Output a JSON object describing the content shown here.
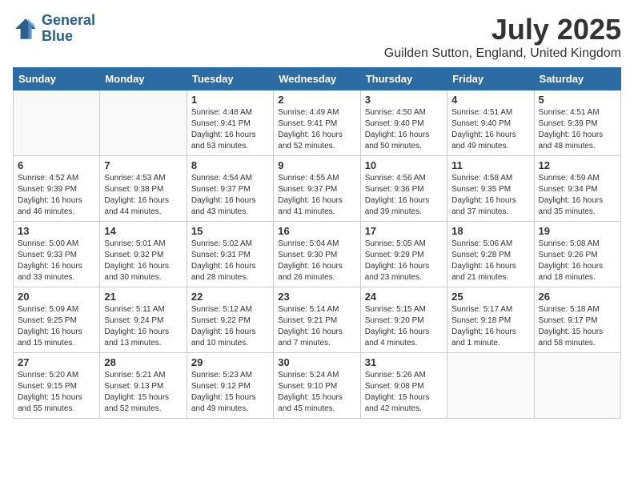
{
  "header": {
    "logo_line1": "General",
    "logo_line2": "Blue",
    "month": "July 2025",
    "location": "Guilden Sutton, England, United Kingdom"
  },
  "weekdays": [
    "Sunday",
    "Monday",
    "Tuesday",
    "Wednesday",
    "Thursday",
    "Friday",
    "Saturday"
  ],
  "weeks": [
    [
      {
        "day": "",
        "info": ""
      },
      {
        "day": "",
        "info": ""
      },
      {
        "day": "1",
        "info": "Sunrise: 4:48 AM\nSunset: 9:41 PM\nDaylight: 16 hours and 53 minutes."
      },
      {
        "day": "2",
        "info": "Sunrise: 4:49 AM\nSunset: 9:41 PM\nDaylight: 16 hours and 52 minutes."
      },
      {
        "day": "3",
        "info": "Sunrise: 4:50 AM\nSunset: 9:40 PM\nDaylight: 16 hours and 50 minutes."
      },
      {
        "day": "4",
        "info": "Sunrise: 4:51 AM\nSunset: 9:40 PM\nDaylight: 16 hours and 49 minutes."
      },
      {
        "day": "5",
        "info": "Sunrise: 4:51 AM\nSunset: 9:39 PM\nDaylight: 16 hours and 48 minutes."
      }
    ],
    [
      {
        "day": "6",
        "info": "Sunrise: 4:52 AM\nSunset: 9:39 PM\nDaylight: 16 hours and 46 minutes."
      },
      {
        "day": "7",
        "info": "Sunrise: 4:53 AM\nSunset: 9:38 PM\nDaylight: 16 hours and 44 minutes."
      },
      {
        "day": "8",
        "info": "Sunrise: 4:54 AM\nSunset: 9:37 PM\nDaylight: 16 hours and 43 minutes."
      },
      {
        "day": "9",
        "info": "Sunrise: 4:55 AM\nSunset: 9:37 PM\nDaylight: 16 hours and 41 minutes."
      },
      {
        "day": "10",
        "info": "Sunrise: 4:56 AM\nSunset: 9:36 PM\nDaylight: 16 hours and 39 minutes."
      },
      {
        "day": "11",
        "info": "Sunrise: 4:58 AM\nSunset: 9:35 PM\nDaylight: 16 hours and 37 minutes."
      },
      {
        "day": "12",
        "info": "Sunrise: 4:59 AM\nSunset: 9:34 PM\nDaylight: 16 hours and 35 minutes."
      }
    ],
    [
      {
        "day": "13",
        "info": "Sunrise: 5:00 AM\nSunset: 9:33 PM\nDaylight: 16 hours and 33 minutes."
      },
      {
        "day": "14",
        "info": "Sunrise: 5:01 AM\nSunset: 9:32 PM\nDaylight: 16 hours and 30 minutes."
      },
      {
        "day": "15",
        "info": "Sunrise: 5:02 AM\nSunset: 9:31 PM\nDaylight: 16 hours and 28 minutes."
      },
      {
        "day": "16",
        "info": "Sunrise: 5:04 AM\nSunset: 9:30 PM\nDaylight: 16 hours and 26 minutes."
      },
      {
        "day": "17",
        "info": "Sunrise: 5:05 AM\nSunset: 9:29 PM\nDaylight: 16 hours and 23 minutes."
      },
      {
        "day": "18",
        "info": "Sunrise: 5:06 AM\nSunset: 9:28 PM\nDaylight: 16 hours and 21 minutes."
      },
      {
        "day": "19",
        "info": "Sunrise: 5:08 AM\nSunset: 9:26 PM\nDaylight: 16 hours and 18 minutes."
      }
    ],
    [
      {
        "day": "20",
        "info": "Sunrise: 5:09 AM\nSunset: 9:25 PM\nDaylight: 16 hours and 15 minutes."
      },
      {
        "day": "21",
        "info": "Sunrise: 5:11 AM\nSunset: 9:24 PM\nDaylight: 16 hours and 13 minutes."
      },
      {
        "day": "22",
        "info": "Sunrise: 5:12 AM\nSunset: 9:22 PM\nDaylight: 16 hours and 10 minutes."
      },
      {
        "day": "23",
        "info": "Sunrise: 5:14 AM\nSunset: 9:21 PM\nDaylight: 16 hours and 7 minutes."
      },
      {
        "day": "24",
        "info": "Sunrise: 5:15 AM\nSunset: 9:20 PM\nDaylight: 16 hours and 4 minutes."
      },
      {
        "day": "25",
        "info": "Sunrise: 5:17 AM\nSunset: 9:18 PM\nDaylight: 16 hours and 1 minute."
      },
      {
        "day": "26",
        "info": "Sunrise: 5:18 AM\nSunset: 9:17 PM\nDaylight: 15 hours and 58 minutes."
      }
    ],
    [
      {
        "day": "27",
        "info": "Sunrise: 5:20 AM\nSunset: 9:15 PM\nDaylight: 15 hours and 55 minutes."
      },
      {
        "day": "28",
        "info": "Sunrise: 5:21 AM\nSunset: 9:13 PM\nDaylight: 15 hours and 52 minutes."
      },
      {
        "day": "29",
        "info": "Sunrise: 5:23 AM\nSunset: 9:12 PM\nDaylight: 15 hours and 49 minutes."
      },
      {
        "day": "30",
        "info": "Sunrise: 5:24 AM\nSunset: 9:10 PM\nDaylight: 15 hours and 45 minutes."
      },
      {
        "day": "31",
        "info": "Sunrise: 5:26 AM\nSunset: 9:08 PM\nDaylight: 15 hours and 42 minutes."
      },
      {
        "day": "",
        "info": ""
      },
      {
        "day": "",
        "info": ""
      }
    ]
  ]
}
